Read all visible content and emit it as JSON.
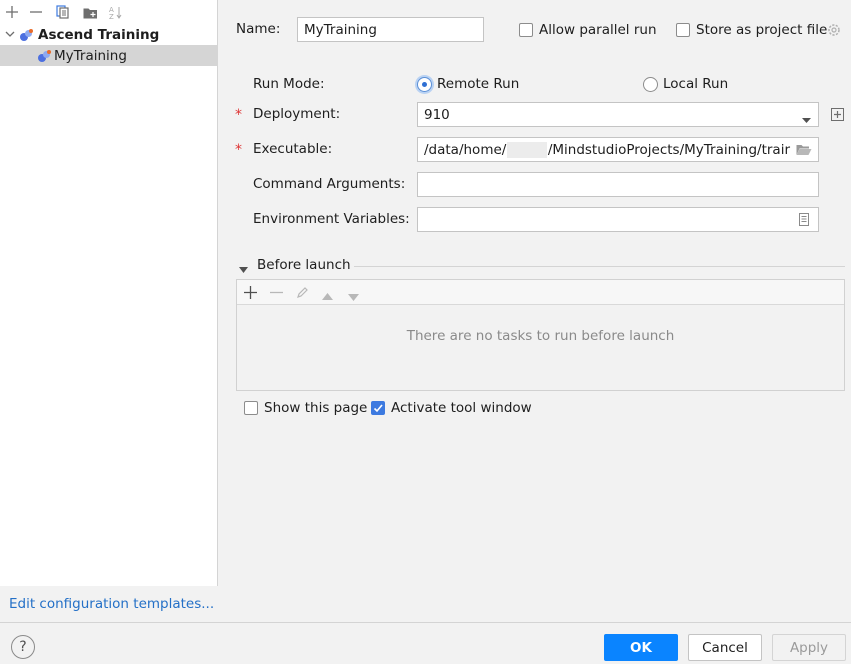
{
  "left": {
    "toolbar": {
      "add_icon": "plus-icon",
      "remove_icon": "minus-icon",
      "copy_icon": "copy-icon",
      "folder_icon": "new-folder-icon",
      "sort_icon": "sort-alphabetical-icon"
    },
    "tree": {
      "group_label": "Ascend Training",
      "child_label": "MyTraining"
    },
    "edit_templates_link": "Edit configuration templates..."
  },
  "form": {
    "name_label": "Name:",
    "name_value": "MyTraining",
    "allow_parallel_label": "Allow parallel run",
    "allow_parallel_checked": false,
    "store_project_label": "Store as project file",
    "store_project_checked": false,
    "run_mode_label": "Run Mode:",
    "remote_run_label": "Remote Run",
    "local_run_label": "Local Run",
    "run_mode_selected": "Remote Run",
    "deployment_label": "Deployment:",
    "deployment_value": "910",
    "executable_label": "Executable:",
    "executable_prefix": "/data/home/",
    "executable_suffix": "/MindstudioProjects/MyTraining/trair",
    "command_args_label": "Command Arguments:",
    "command_args_value": "",
    "env_vars_label": "Environment Variables:",
    "env_vars_value": "",
    "required_marker": "*"
  },
  "before_launch": {
    "title": "Before launch",
    "empty_text": "There are no tasks to run before launch"
  },
  "options": {
    "show_page_label": "Show this page",
    "show_page_checked": false,
    "activate_tool_label": "Activate tool window",
    "activate_tool_checked": true
  },
  "footer": {
    "help_label": "?",
    "ok_label": "OK",
    "cancel_label": "Cancel",
    "apply_label": "Apply"
  },
  "colors": {
    "accent": "#0a84ff",
    "link": "#2470c7",
    "required": "#dd3333"
  }
}
